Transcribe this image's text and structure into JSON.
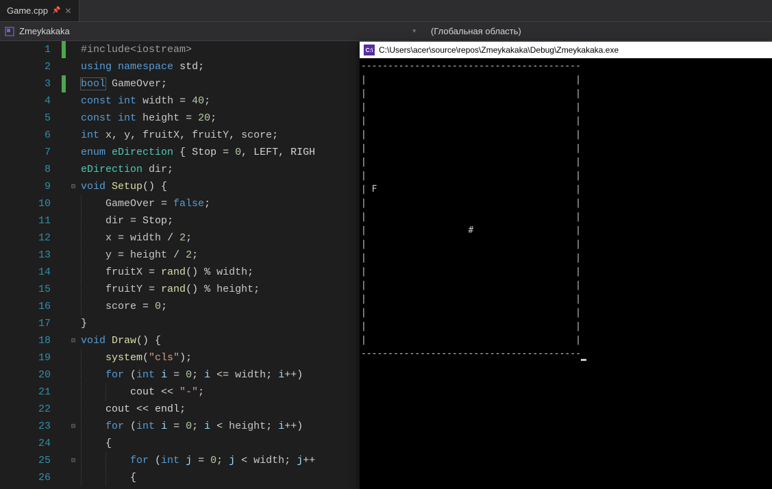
{
  "tab": {
    "filename": "Game.cpp"
  },
  "nav": {
    "project": "Zmeykakaka",
    "scope": "(Глобальная область)"
  },
  "code": {
    "lines": [
      {
        "n": 1,
        "marker": "green",
        "fold": "",
        "tokens": [
          [
            "preproc",
            "#include"
          ],
          [
            "include",
            "<iostream>"
          ]
        ]
      },
      {
        "n": 2,
        "marker": "",
        "fold": "",
        "tokens": [
          [
            "keyword",
            "using"
          ],
          [
            "default",
            " "
          ],
          [
            "keyword",
            "namespace"
          ],
          [
            "default",
            " "
          ],
          [
            "ident",
            "std"
          ],
          [
            "punct",
            ";"
          ]
        ]
      },
      {
        "n": 3,
        "marker": "green",
        "fold": "",
        "tokens": [
          [
            "keyword",
            "bool"
          ],
          [
            "default",
            " "
          ],
          [
            "global",
            "GameOver"
          ],
          [
            "punct",
            ";"
          ]
        ],
        "highlightWord": "bool"
      },
      {
        "n": 4,
        "marker": "",
        "fold": "",
        "tokens": [
          [
            "keyword",
            "const"
          ],
          [
            "default",
            " "
          ],
          [
            "keyword",
            "int"
          ],
          [
            "default",
            " "
          ],
          [
            "global",
            "width"
          ],
          [
            "default",
            " = "
          ],
          [
            "num",
            "40"
          ],
          [
            "punct",
            ";"
          ]
        ]
      },
      {
        "n": 5,
        "marker": "",
        "fold": "",
        "tokens": [
          [
            "keyword",
            "const"
          ],
          [
            "default",
            " "
          ],
          [
            "keyword",
            "int"
          ],
          [
            "default",
            " "
          ],
          [
            "global",
            "height"
          ],
          [
            "default",
            " = "
          ],
          [
            "num",
            "20"
          ],
          [
            "punct",
            ";"
          ]
        ]
      },
      {
        "n": 6,
        "marker": "",
        "fold": "",
        "tokens": [
          [
            "keyword",
            "int"
          ],
          [
            "default",
            " "
          ],
          [
            "global",
            "x"
          ],
          [
            "punct",
            ", "
          ],
          [
            "global",
            "y"
          ],
          [
            "punct",
            ", "
          ],
          [
            "global",
            "fruitX"
          ],
          [
            "punct",
            ", "
          ],
          [
            "global",
            "fruitY"
          ],
          [
            "punct",
            ", "
          ],
          [
            "global",
            "score"
          ],
          [
            "punct",
            ";"
          ]
        ]
      },
      {
        "n": 7,
        "marker": "",
        "fold": "",
        "tokens": [
          [
            "keyword",
            "enum"
          ],
          [
            "default",
            " "
          ],
          [
            "cls",
            "eDirection"
          ],
          [
            "default",
            " { "
          ],
          [
            "const",
            "Stop"
          ],
          [
            "default",
            " = "
          ],
          [
            "num",
            "0"
          ],
          [
            "punct",
            ", "
          ],
          [
            "const",
            "LEFT"
          ],
          [
            "punct",
            ", "
          ],
          [
            "const",
            "RIGH"
          ]
        ]
      },
      {
        "n": 8,
        "marker": "",
        "fold": "",
        "tokens": [
          [
            "cls",
            "eDirection"
          ],
          [
            "default",
            " "
          ],
          [
            "global",
            "dir"
          ],
          [
            "punct",
            ";"
          ]
        ]
      },
      {
        "n": 9,
        "marker": "",
        "fold": "⊟",
        "tokens": [
          [
            "keyword",
            "void"
          ],
          [
            "default",
            " "
          ],
          [
            "func",
            "Setup"
          ],
          [
            "punct",
            "() {"
          ]
        ]
      },
      {
        "n": 10,
        "marker": "",
        "fold": "",
        "tokens": [
          [
            "default",
            "    "
          ],
          [
            "global",
            "GameOver"
          ],
          [
            "default",
            " = "
          ],
          [
            "keyword",
            "false"
          ],
          [
            "punct",
            ";"
          ]
        ],
        "indent": 1
      },
      {
        "n": 11,
        "marker": "",
        "fold": "",
        "tokens": [
          [
            "default",
            "    "
          ],
          [
            "global",
            "dir"
          ],
          [
            "default",
            " = "
          ],
          [
            "const",
            "Stop"
          ],
          [
            "punct",
            ";"
          ]
        ],
        "indent": 1
      },
      {
        "n": 12,
        "marker": "",
        "fold": "",
        "tokens": [
          [
            "default",
            "    "
          ],
          [
            "global",
            "x"
          ],
          [
            "default",
            " = "
          ],
          [
            "global",
            "width"
          ],
          [
            "default",
            " / "
          ],
          [
            "num",
            "2"
          ],
          [
            "punct",
            ";"
          ]
        ],
        "indent": 1
      },
      {
        "n": 13,
        "marker": "",
        "fold": "",
        "tokens": [
          [
            "default",
            "    "
          ],
          [
            "global",
            "y"
          ],
          [
            "default",
            " = "
          ],
          [
            "global",
            "height"
          ],
          [
            "default",
            " / "
          ],
          [
            "num",
            "2"
          ],
          [
            "punct",
            ";"
          ]
        ],
        "indent": 1
      },
      {
        "n": 14,
        "marker": "",
        "fold": "",
        "tokens": [
          [
            "default",
            "    "
          ],
          [
            "global",
            "fruitX"
          ],
          [
            "default",
            " = "
          ],
          [
            "func",
            "rand"
          ],
          [
            "punct",
            "() % "
          ],
          [
            "global",
            "width"
          ],
          [
            "punct",
            ";"
          ]
        ],
        "indent": 1
      },
      {
        "n": 15,
        "marker": "",
        "fold": "",
        "tokens": [
          [
            "default",
            "    "
          ],
          [
            "global",
            "fruitY"
          ],
          [
            "default",
            " = "
          ],
          [
            "func",
            "rand"
          ],
          [
            "punct",
            "() % "
          ],
          [
            "global",
            "height"
          ],
          [
            "punct",
            ";"
          ]
        ],
        "indent": 1
      },
      {
        "n": 16,
        "marker": "",
        "fold": "",
        "tokens": [
          [
            "default",
            "    "
          ],
          [
            "global",
            "score"
          ],
          [
            "default",
            " = "
          ],
          [
            "num",
            "0"
          ],
          [
            "punct",
            ";"
          ]
        ],
        "indent": 1
      },
      {
        "n": 17,
        "marker": "",
        "fold": "",
        "tokens": [
          [
            "punct",
            "}"
          ]
        ]
      },
      {
        "n": 18,
        "marker": "",
        "fold": "⊟",
        "tokens": [
          [
            "keyword",
            "void"
          ],
          [
            "default",
            " "
          ],
          [
            "func",
            "Draw"
          ],
          [
            "punct",
            "() {"
          ]
        ]
      },
      {
        "n": 19,
        "marker": "",
        "fold": "",
        "tokens": [
          [
            "default",
            "    "
          ],
          [
            "func",
            "system"
          ],
          [
            "punct",
            "("
          ],
          [
            "str",
            "\"cls\""
          ],
          [
            "punct",
            ");"
          ]
        ],
        "indent": 1
      },
      {
        "n": 20,
        "marker": "",
        "fold": "",
        "tokens": [
          [
            "default",
            "    "
          ],
          [
            "keyword",
            "for"
          ],
          [
            "default",
            " ("
          ],
          [
            "keyword",
            "int"
          ],
          [
            "default",
            " "
          ],
          [
            "gray",
            "i"
          ],
          [
            "default",
            " = "
          ],
          [
            "num",
            "0"
          ],
          [
            "punct",
            "; "
          ],
          [
            "gray",
            "i"
          ],
          [
            "default",
            " <= "
          ],
          [
            "global",
            "width"
          ],
          [
            "punct",
            "; "
          ],
          [
            "gray",
            "i"
          ],
          [
            "punct",
            "++)"
          ]
        ],
        "indent": 1
      },
      {
        "n": 21,
        "marker": "",
        "fold": "",
        "tokens": [
          [
            "default",
            "        "
          ],
          [
            "ident",
            "cout"
          ],
          [
            "default",
            " << "
          ],
          [
            "str",
            "\"-\""
          ],
          [
            "punct",
            ";"
          ]
        ],
        "indent": 2
      },
      {
        "n": 22,
        "marker": "",
        "fold": "",
        "tokens": [
          [
            "default",
            "    "
          ],
          [
            "ident",
            "cout"
          ],
          [
            "default",
            " << "
          ],
          [
            "ident",
            "endl"
          ],
          [
            "punct",
            ";"
          ]
        ],
        "indent": 1
      },
      {
        "n": 23,
        "marker": "",
        "fold": "⊟",
        "tokens": [
          [
            "default",
            "    "
          ],
          [
            "keyword",
            "for"
          ],
          [
            "default",
            " ("
          ],
          [
            "keyword",
            "int"
          ],
          [
            "default",
            " "
          ],
          [
            "gray",
            "i"
          ],
          [
            "default",
            " = "
          ],
          [
            "num",
            "0"
          ],
          [
            "punct",
            "; "
          ],
          [
            "gray",
            "i"
          ],
          [
            "default",
            " < "
          ],
          [
            "global",
            "height"
          ],
          [
            "punct",
            "; "
          ],
          [
            "gray",
            "i"
          ],
          [
            "punct",
            "++)"
          ]
        ],
        "indent": 1
      },
      {
        "n": 24,
        "marker": "",
        "fold": "",
        "tokens": [
          [
            "default",
            "    "
          ],
          [
            "punct",
            "{"
          ]
        ],
        "indent": 1
      },
      {
        "n": 25,
        "marker": "",
        "fold": "⊟",
        "tokens": [
          [
            "default",
            "        "
          ],
          [
            "keyword",
            "for"
          ],
          [
            "default",
            " ("
          ],
          [
            "keyword",
            "int"
          ],
          [
            "default",
            " "
          ],
          [
            "gray",
            "j"
          ],
          [
            "default",
            " = "
          ],
          [
            "num",
            "0"
          ],
          [
            "punct",
            "; "
          ],
          [
            "gray",
            "j"
          ],
          [
            "default",
            " < "
          ],
          [
            "global",
            "width"
          ],
          [
            "punct",
            "; "
          ],
          [
            "gray",
            "j"
          ],
          [
            "punct",
            "++"
          ]
        ],
        "indent": 2
      },
      {
        "n": 26,
        "marker": "",
        "fold": "",
        "tokens": [
          [
            "default",
            "        "
          ],
          [
            "punct",
            "{"
          ]
        ],
        "indent": 2
      }
    ]
  },
  "console": {
    "title": "C:\\Users\\acer\\source\\repos\\Zmeykakaka\\Debug\\Zmeykakaka.exe",
    "output": "-----------------------------------------\n|                                       |\n|                                       |\n|                                       |\n|                                       |\n|                                       |\n|                                       |\n|                                       |\n|                                       |\n| F                                     |\n|                                       |\n|                                       |\n|                   #                   |\n|                                       |\n|                                       |\n|                                       |\n|                                       |\n|                                       |\n|                                       |\n|                                       |\n|                                       |\n-----------------------------------------"
  }
}
